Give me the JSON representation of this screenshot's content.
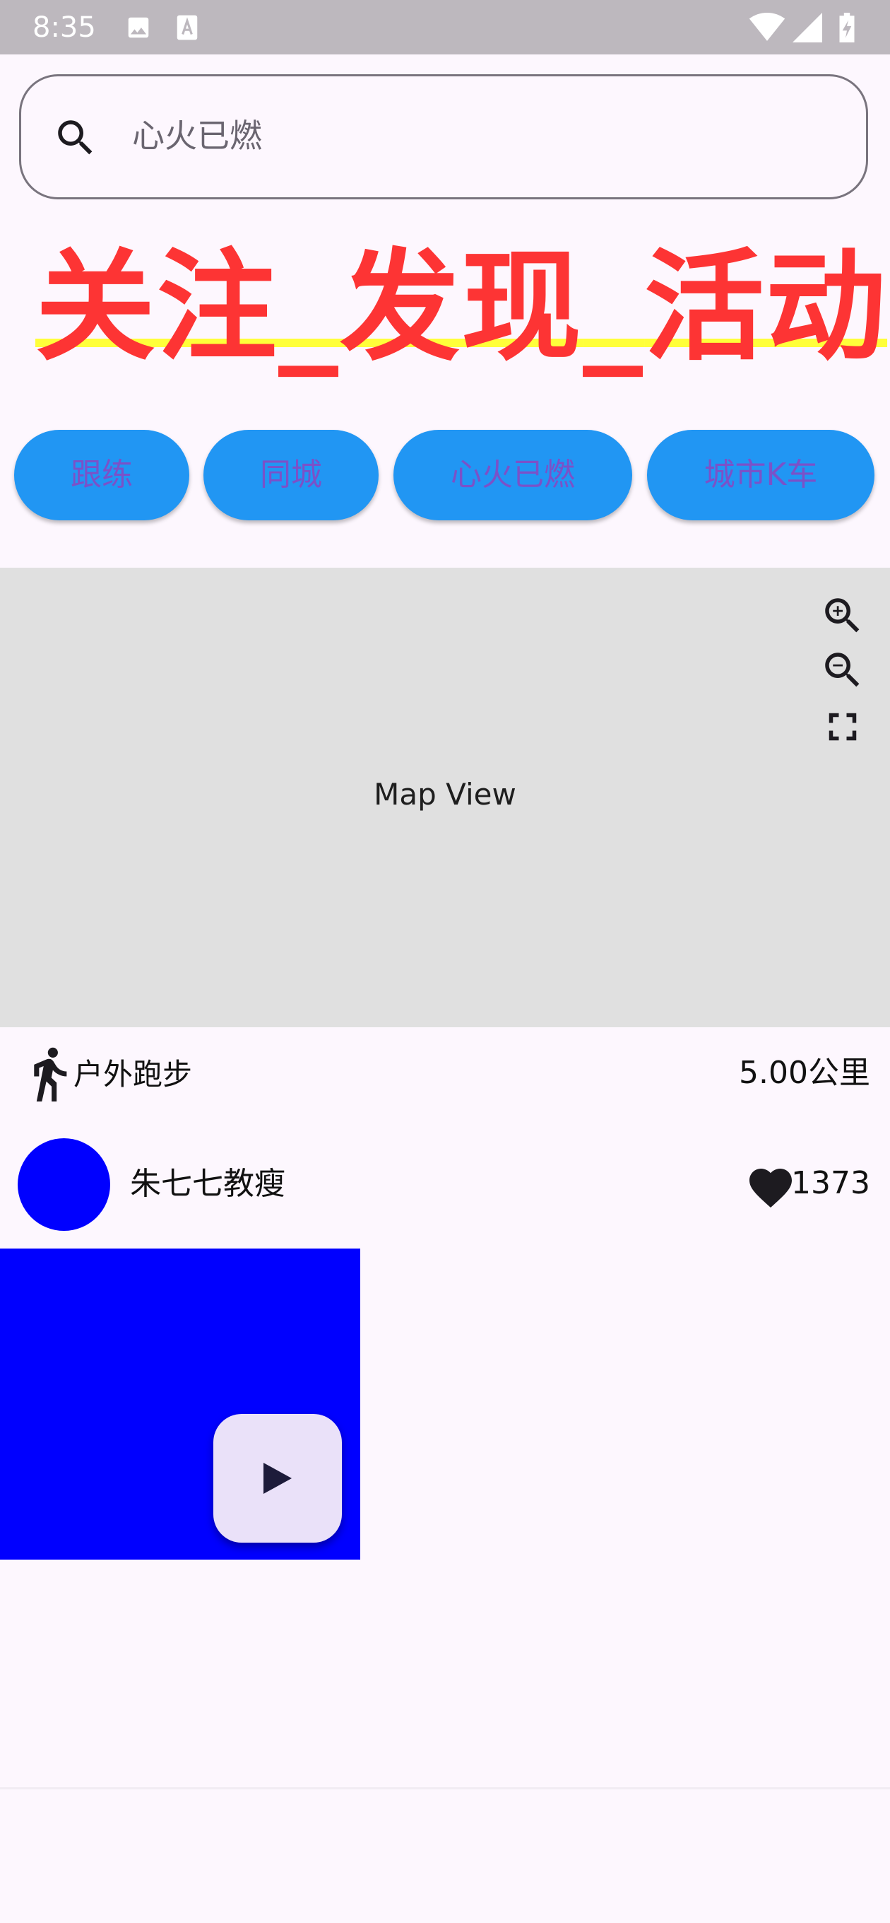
{
  "status_bar": {
    "time": "8:35",
    "left_icons": [
      "image-icon",
      "text-a-icon"
    ],
    "right_icons": [
      "wifi-icon",
      "signal-icon",
      "battery-charging-icon"
    ]
  },
  "search": {
    "placeholder": "心火已燃",
    "icon": "search-icon"
  },
  "headline": {
    "tabs": [
      "关注",
      "发现",
      "活动"
    ],
    "separator": "_",
    "color": "#fd3434",
    "underline_color": "#ffff3a"
  },
  "chips": [
    {
      "label": "跟练"
    },
    {
      "label": "同城"
    },
    {
      "label": "心火已燃"
    },
    {
      "label": "城市K车"
    }
  ],
  "chip_colors": {
    "background": "#2196f3",
    "text": "#7b51c8"
  },
  "map": {
    "label": "Map View",
    "controls": [
      "zoom-in-icon",
      "zoom-out-icon",
      "fullscreen-icon"
    ]
  },
  "activity": {
    "icon": "walking-person-icon",
    "name": "户外跑步",
    "distance": "5.00公里"
  },
  "post": {
    "author": "朱七七教瘦",
    "likes": "1373",
    "avatar_color": "#0000ff",
    "media_color": "#0000ff",
    "play_icon": "play-icon"
  }
}
